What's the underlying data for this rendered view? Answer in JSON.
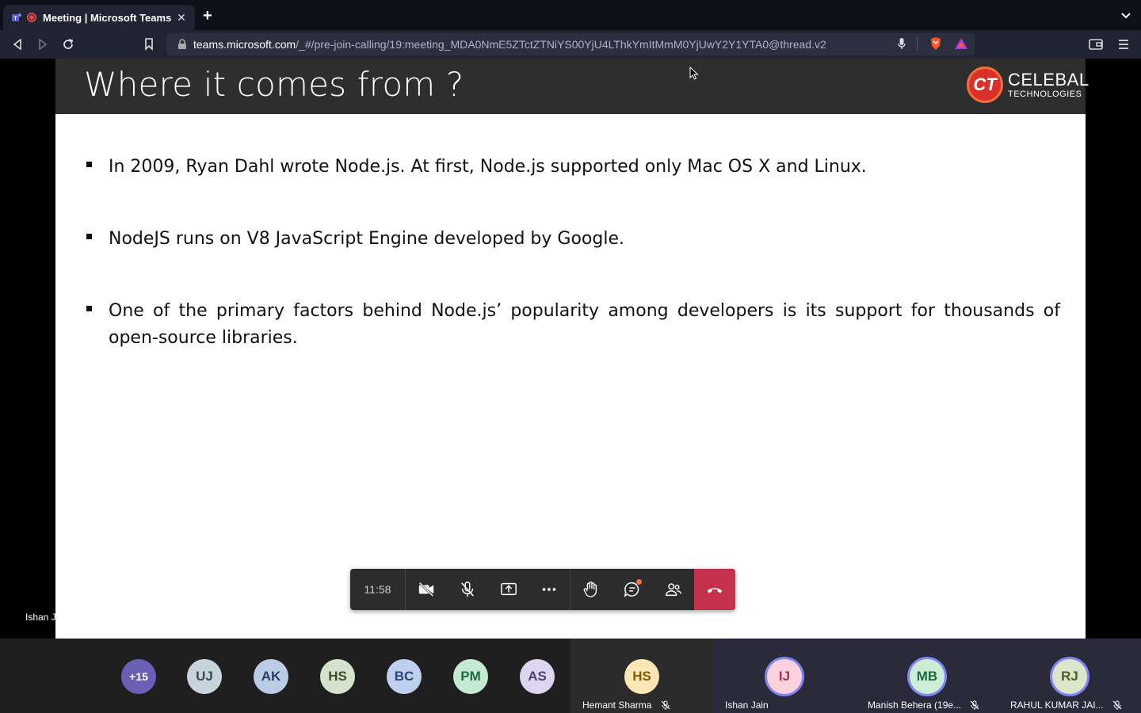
{
  "browser": {
    "tab_title": "Meeting | Microsoft Teams",
    "url_host": "teams.microsoft.com",
    "url_path": "/_#/pre-join-calling/19:meeting_MDA0NmE5ZTctZTNiYS00YjU4LThkYmItMmM0YjUwY2Y1YTA0@thread.v2"
  },
  "slide": {
    "title": "Where it comes from ?",
    "logo_mark": "CT",
    "logo_line1": "CELEBAL",
    "logo_line2": "TECHNOLOGIES",
    "bullets": [
      "In 2009, Ryan Dahl wrote Node.js. At first, Node.js supported only Mac OS X and Linux.",
      "NodeJS runs on V8 JavaScript Engine developed by Google.",
      "One of the primary factors behind Node.js’ popularity among developers is its support for thousands of open-source libraries."
    ]
  },
  "presenter": "Ishan Jain",
  "controls": {
    "timer": "11:58"
  },
  "participants": {
    "overflow": "+15",
    "avatars": [
      {
        "initials": "UJ",
        "bg": "#c8d4dc",
        "fg": "#3b4a5a"
      },
      {
        "initials": "AK",
        "bg": "#bccbe6",
        "fg": "#2c3e63"
      },
      {
        "initials": "HS",
        "bg": "#d5e2cc",
        "fg": "#3a4d30"
      },
      {
        "initials": "BC",
        "bg": "#bfd0ee",
        "fg": "#2b4577"
      },
      {
        "initials": "PM",
        "bg": "#c4ead3",
        "fg": "#1f6b3e"
      },
      {
        "initials": "AS",
        "bg": "#ddd6ee",
        "fg": "#4d3f74"
      }
    ],
    "tiles": [
      {
        "initials": "HS",
        "name": "Hemant Sharma",
        "bg": "#fbe7b5",
        "fg": "#835c00"
      },
      {
        "initials": "IJ",
        "name": "Ishan Jain",
        "bg": "#fcd3dd",
        "fg": "#a33450"
      },
      {
        "initials": "MB",
        "name": "Manish Behera (19e...",
        "bg": "#cdeed6",
        "fg": "#1f6b3e"
      },
      {
        "initials": "RJ",
        "name": "RAHUL KUMAR JAI...",
        "bg": "#dce6c9",
        "fg": "#4a5e28"
      }
    ]
  }
}
